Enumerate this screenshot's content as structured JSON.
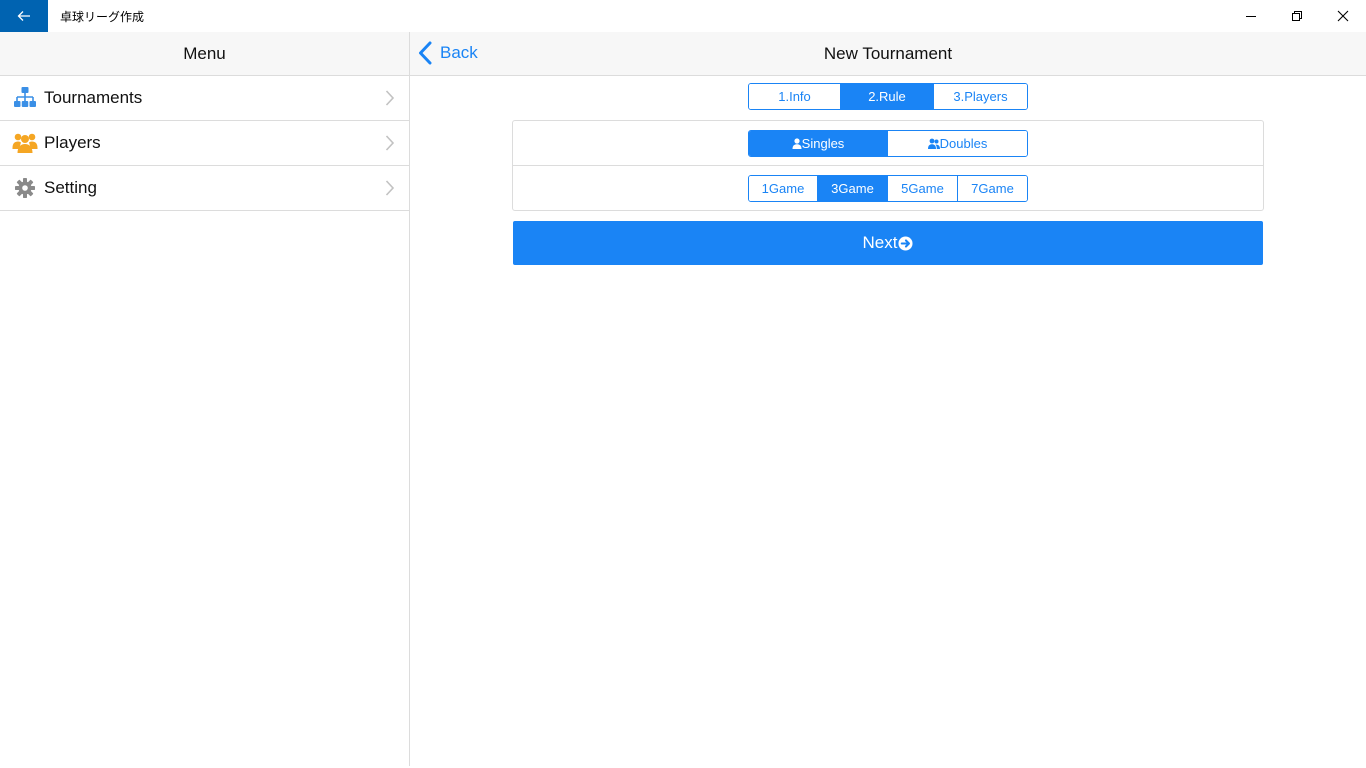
{
  "window": {
    "title": "卓球リーグ作成"
  },
  "sidebar": {
    "header": "Menu",
    "items": [
      {
        "label": "Tournaments",
        "icon": "sitemap-icon",
        "color": "#3a8fe6"
      },
      {
        "label": "Players",
        "icon": "users-icon",
        "color": "#f5a623"
      },
      {
        "label": "Setting",
        "icon": "gear-icon",
        "color": "#8a8a8a"
      }
    ]
  },
  "nav": {
    "back_label": "Back",
    "title": "New Tournament"
  },
  "steps": {
    "items": [
      "1.Info",
      "2.Rule",
      "3.Players"
    ],
    "selected": "2.Rule"
  },
  "match_type": {
    "items": [
      "Singles",
      "Doubles"
    ],
    "selected": "Singles"
  },
  "games": {
    "items": [
      "1Game",
      "3Game",
      "5Game",
      "7Game"
    ],
    "selected": "3Game"
  },
  "next_label": "Next",
  "colors": {
    "accent": "#1a84f5",
    "titlebar_back": "#0063b1"
  }
}
